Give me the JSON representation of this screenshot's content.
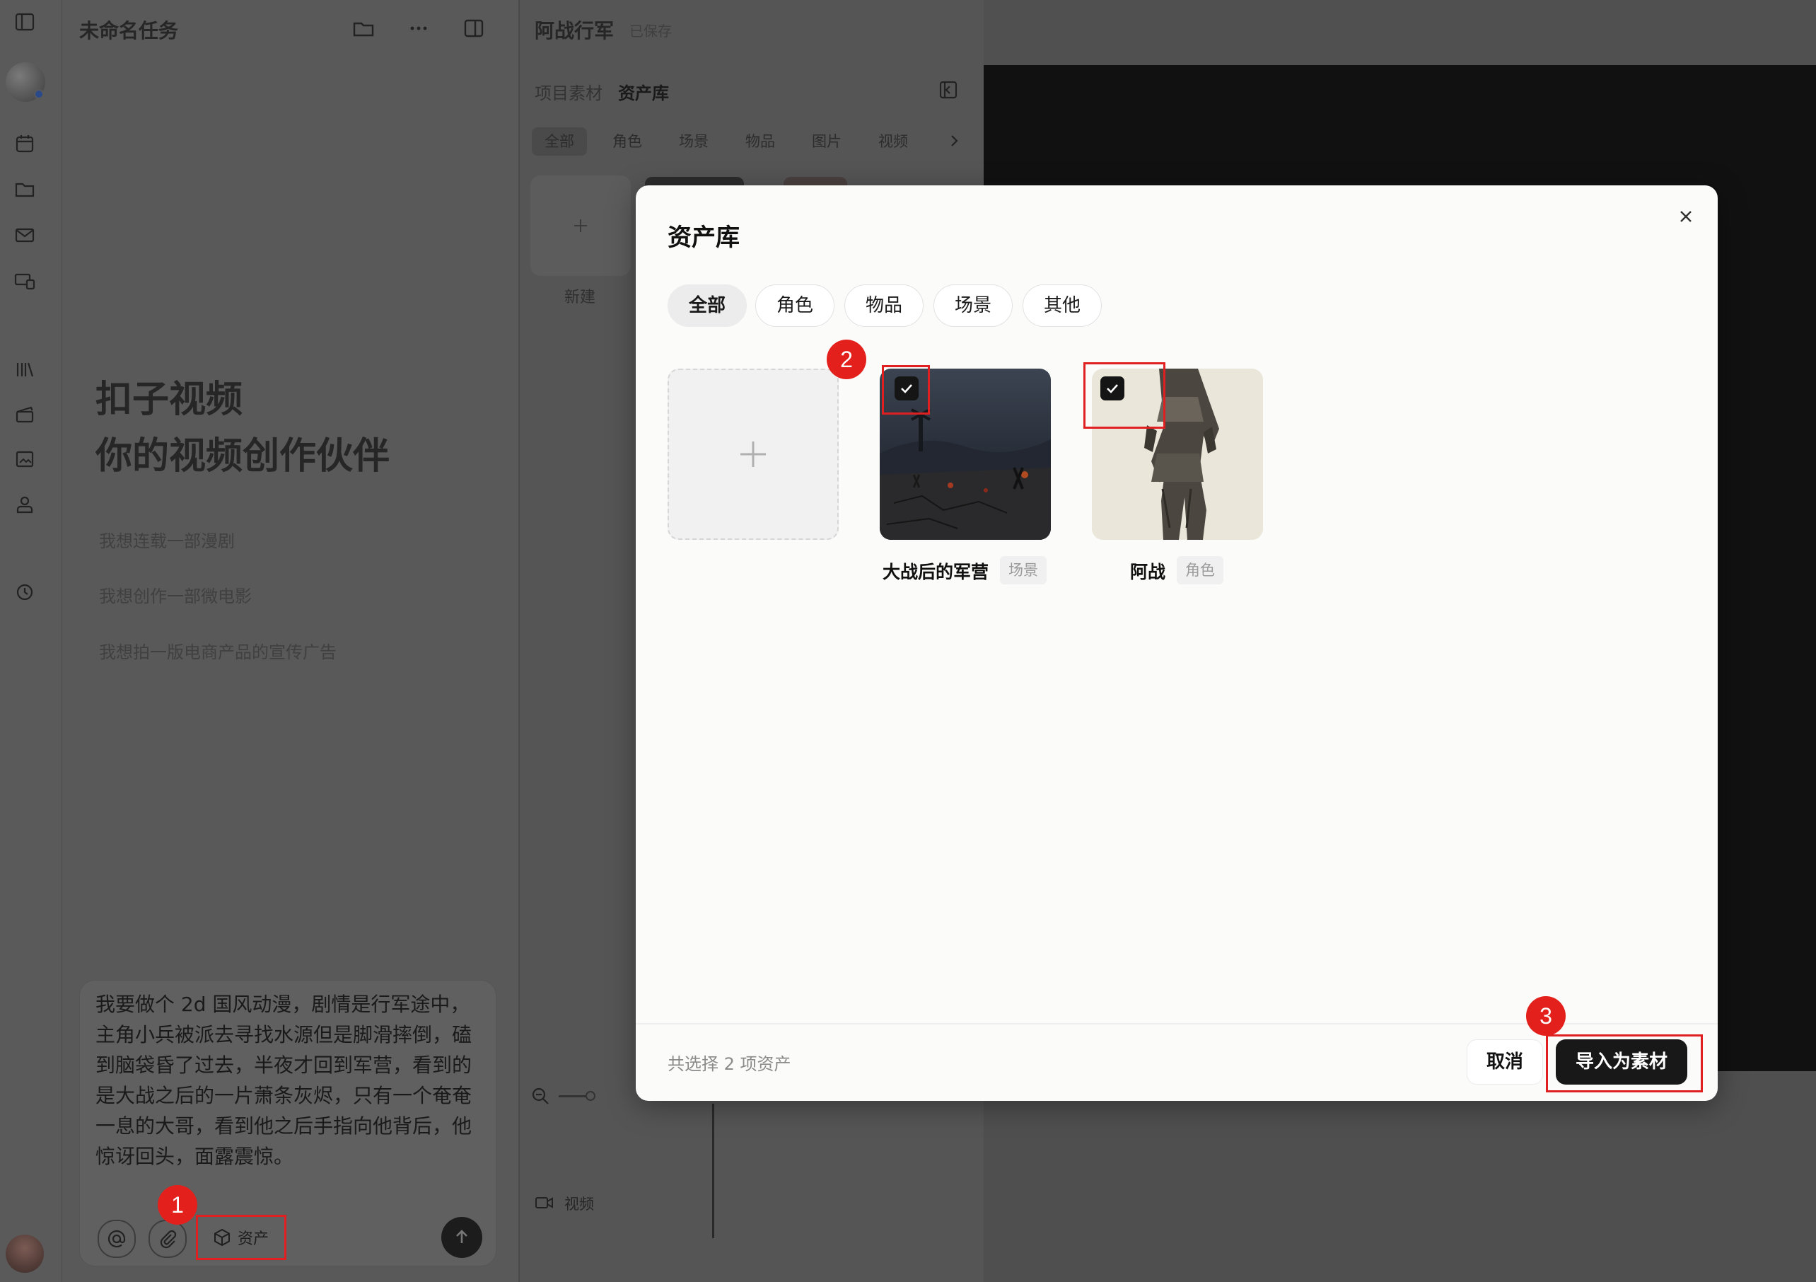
{
  "sidebar": {
    "icons": [
      "expand-sidebar-icon",
      "avatar",
      "calendar-icon",
      "folder-icon",
      "mail-icon",
      "devices-icon",
      "library-icon",
      "clapper-icon",
      "image-icon",
      "person-stamp-icon",
      "history-icon",
      "user-avatar"
    ]
  },
  "left_panel": {
    "title": "未命名任务",
    "hero_line1": "扣子视频",
    "hero_line2": "你的视频创作伙伴",
    "suggestions": [
      "我想连载一部漫剧",
      "我想创作一部微电影",
      "我想拍一版电商产品的宣传广告"
    ],
    "composer_text": "我要做个 2d 国风动漫，剧情是行军途中，主角小兵被派去寻找水源但是脚滑摔倒，磕到脑袋昏了过去，半夜才回到军营，看到的是大战之后的一片萧条灰烬，只有一个奄奄一息的大哥，看到他之后手指向他背后，他惊讶回头，面露震惊。",
    "asset_button_label": "资产"
  },
  "project": {
    "title": "阿战行军",
    "saved_status": "已保存",
    "tabs_header": [
      "项目素材",
      "资产库"
    ],
    "filter_tabs": [
      "全部",
      "角色",
      "场景",
      "物品",
      "图片",
      "视频"
    ],
    "new_label": "新建",
    "video_track_label": "视频"
  },
  "modal": {
    "title": "资产库",
    "chips": [
      "全部",
      "角色",
      "物品",
      "场景",
      "其他"
    ],
    "active_chip": "全部",
    "assets": [
      {
        "name": "大战后的军营",
        "tag": "场景",
        "checked": true
      },
      {
        "name": "阿战",
        "tag": "角色",
        "checked": true
      }
    ],
    "selection_summary": "共选择 2 项资产",
    "cancel_label": "取消",
    "import_label": "导入为素材"
  },
  "annotations": {
    "step1": "1",
    "step2": "2",
    "step3": "3",
    "color": "#e3201b"
  }
}
